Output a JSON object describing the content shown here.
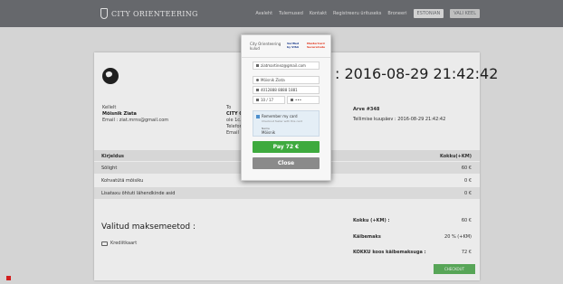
{
  "header": {
    "brand": "CITY ORIENTEERING",
    "nav": [
      "Avaleht",
      "Tulemused",
      "Kontakt",
      "Registreeru ürituseks",
      "Broneeri"
    ],
    "nav_active": "ESTONIAN",
    "nav_lang": "VALI KEEL"
  },
  "invoice": {
    "datetime": ": 2016-08-29 21:42:42",
    "from_label": "Kellelt",
    "from_name": "Mõisnik Ziata",
    "from_email": "Email : ziat.mrns@gmail.com",
    "to_label": "To",
    "to_name": "CITY ORIENTEERING",
    "to_addr": "ole 1c...",
    "to_phone": "Telefon",
    "to_email": "Email",
    "number": "Arve #348",
    "date": "Tellimise kuupäev : 2016-08-29 21:42:42",
    "table_header": {
      "left": "Kirjeldus",
      "right": "Kokku(+KM)"
    },
    "rows": [
      {
        "label": "Sõlight",
        "value": "60 €"
      },
      {
        "label": "Kohvatütä mõisiku",
        "value": "0 €"
      },
      {
        "label": "Lisataxu õhtuti lähendkinde asid",
        "value": "0 €"
      }
    ],
    "payment_title": "Valitud maksemeetod :",
    "payment_item": "Krediitkaart",
    "summary": [
      {
        "label": "Kokku (+KM) :",
        "value": "60 €"
      },
      {
        "label": "Käibemaks",
        "value": "20 % (+KM)"
      },
      {
        "label": "KOKKU koos käibemaksuga :",
        "value": "72 €"
      }
    ],
    "checkout": "CHECKOUT"
  },
  "modal": {
    "merchant": "City Orienteering",
    "merchant_sub": "kulud",
    "visa": "Verified by VISA",
    "mastercard": "MasterCard SecureCode",
    "email": "ziatmartinez@gmail.com",
    "name": "Mõisnik Ziata",
    "card_number": "4012888 8888 1881",
    "expiry": "10 / 17",
    "cvc": "•••",
    "remember_label": "Remember my card",
    "remember_sub": "Checkout faster with this card",
    "remember_field_label": "Name",
    "remember_field_value": "Mõisnik",
    "pay": "Pay 72 €",
    "close": "Close"
  }
}
